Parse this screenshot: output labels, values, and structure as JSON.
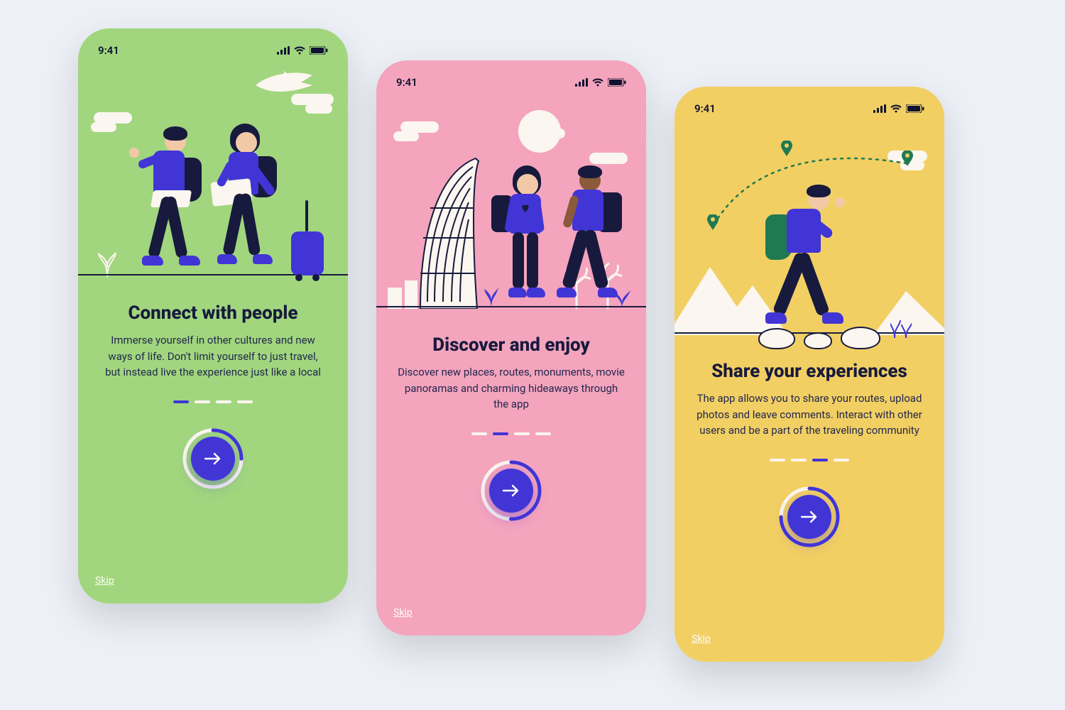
{
  "status": {
    "time": "9:41"
  },
  "colors": {
    "accent": "#4135d6",
    "ink": "#171a3d",
    "cream": "#fbf6ef",
    "skin_light": "#f2c9a7",
    "skin_dark": "#8a5a3b"
  },
  "pager": {
    "total": 4
  },
  "screens": [
    {
      "bg": "#a1d67e",
      "title": "Connect with people",
      "body": "Immerse yourself in other cultures and new ways of life. Don't limit yourself to just travel, but instead live the experience just like a local",
      "active_index": 0,
      "skip": "Skip"
    },
    {
      "bg": "#f4a4bd",
      "title": "Discover and enjoy",
      "body": "Discover new places, routes, monuments, movie panoramas and charming hideaways through the app",
      "active_index": 1,
      "skip": "Skip"
    },
    {
      "bg": "#f2cf63",
      "title": "Share your experiences",
      "body": "The app allows you to share your routes, upload photos and leave comments. Interact with other users and be a part of the traveling community",
      "active_index": 2,
      "skip": "Skip"
    }
  ]
}
